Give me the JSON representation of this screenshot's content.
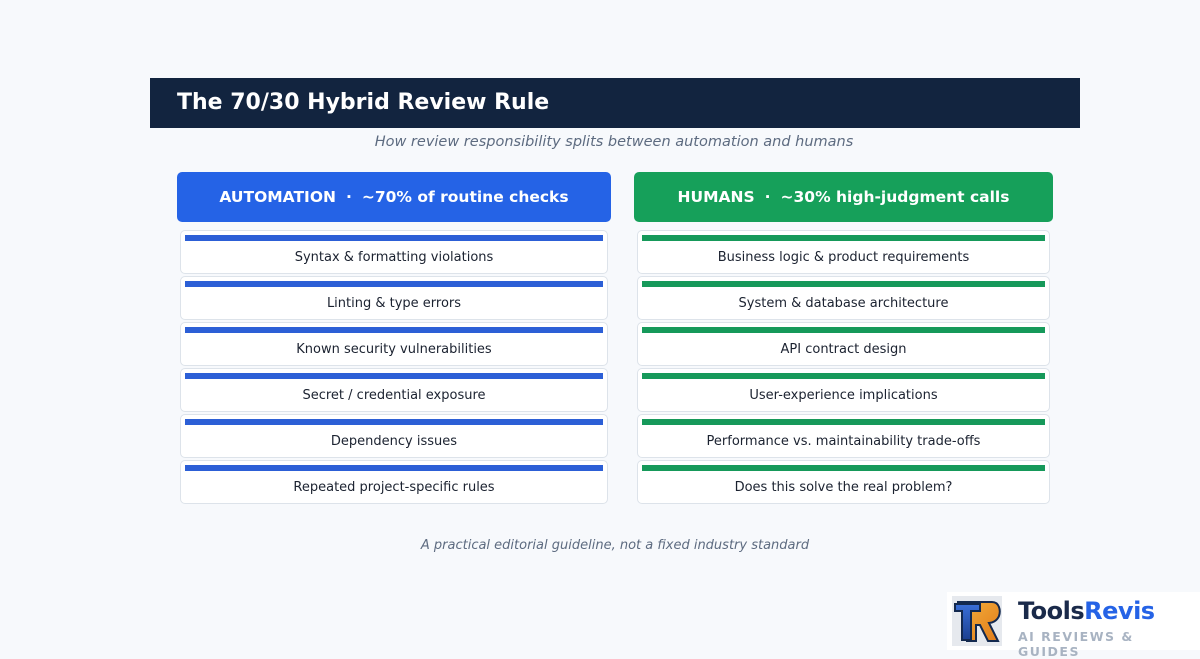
{
  "title": "The 70/30 Hybrid Review Rule",
  "subtitle": "How review responsibility splits between automation and humans",
  "automation": {
    "name": "AUTOMATION",
    "separator": "·",
    "share": "~70% of routine checks",
    "color": "#2563e6",
    "items": [
      "Syntax & formatting violations",
      "Linting & type errors",
      "Known security vulnerabilities",
      "Secret / credential exposure",
      "Dependency issues",
      "Repeated project-specific rules"
    ]
  },
  "humans": {
    "name": "HUMANS",
    "separator": "·",
    "share": "~30% high-judgment calls",
    "color": "#16a05a",
    "items": [
      "Business logic & product requirements",
      "System & database architecture",
      "API contract design",
      "User-experience implications",
      "Performance vs. maintainability trade-offs",
      "Does this solve the real problem?"
    ]
  },
  "footnote": "A practical editorial guideline, not a fixed industry standard",
  "brand": {
    "name_part1": "Tools",
    "name_part2": "Revis",
    "tagline": "AI REVIEWS & GUIDES",
    "logo_letters": "TR"
  }
}
